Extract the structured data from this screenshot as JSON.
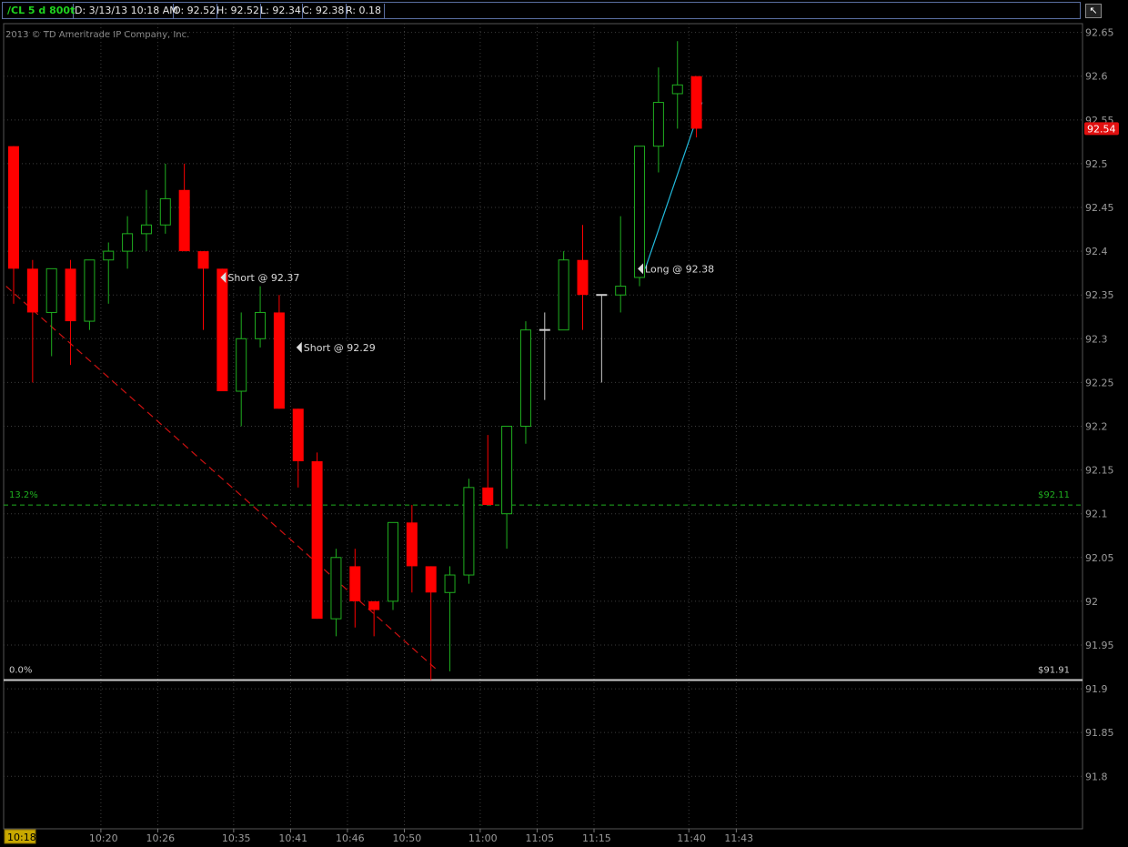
{
  "header": {
    "symbol": "/CL 5 d 800t",
    "date": "D: 3/13/13 10:18 AM",
    "open": "O: 92.52",
    "high": "H: 92.52",
    "low": "L: 92.34",
    "close": "C: 92.38",
    "range": "R: 0.18"
  },
  "copyright": "2013 © TD Ameritrade IP Company, Inc.",
  "colors": {
    "up": "#1fae1f",
    "down": "#ff0000",
    "neutral": "#cccccc",
    "fib": "#1fae1f",
    "trend_down": "#cc1111",
    "trend_up": "#22bbdd",
    "grid": "#3c3c3c",
    "price_tag": "#e01010"
  },
  "chart_data": {
    "type": "candlestick",
    "ylim": [
      91.74,
      92.66
    ],
    "y_ticks": [
      "92.65",
      "92.6",
      "92.55",
      "92.5",
      "92.45",
      "92.4",
      "92.35",
      "92.3",
      "92.25",
      "92.2",
      "92.15",
      "92.1",
      "92.05",
      "92",
      "91.95",
      "91.9",
      "91.85",
      "91.8"
    ],
    "x_labels": [
      {
        "bar": 0.3,
        "label": "10:18"
      },
      {
        "bar": 4.6,
        "label": "10:20"
      },
      {
        "bar": 7.6,
        "label": "10:26"
      },
      {
        "bar": 11.6,
        "label": "10:35"
      },
      {
        "bar": 14.6,
        "label": "10:41"
      },
      {
        "bar": 17.6,
        "label": "10:46"
      },
      {
        "bar": 20.6,
        "label": "10:50"
      },
      {
        "bar": 24.6,
        "label": "11:00"
      },
      {
        "bar": 27.6,
        "label": "11:05"
      },
      {
        "bar": 30.6,
        "label": "11:15"
      },
      {
        "bar": 35.6,
        "label": "11:40"
      },
      {
        "bar": 38.1,
        "label": "11:43"
      }
    ],
    "candles": [
      {
        "o": 92.52,
        "h": 92.52,
        "l": 92.34,
        "c": 92.38
      },
      {
        "o": 92.38,
        "h": 92.39,
        "l": 92.25,
        "c": 92.33
      },
      {
        "o": 92.33,
        "h": 92.38,
        "l": 92.28,
        "c": 92.38
      },
      {
        "o": 92.38,
        "h": 92.39,
        "l": 92.27,
        "c": 92.32
      },
      {
        "o": 92.32,
        "h": 92.39,
        "l": 92.31,
        "c": 92.39
      },
      {
        "o": 92.39,
        "h": 92.41,
        "l": 92.34,
        "c": 92.4
      },
      {
        "o": 92.4,
        "h": 92.44,
        "l": 92.38,
        "c": 92.42
      },
      {
        "o": 92.42,
        "h": 92.47,
        "l": 92.4,
        "c": 92.43
      },
      {
        "o": 92.43,
        "h": 92.5,
        "l": 92.42,
        "c": 92.46
      },
      {
        "o": 92.47,
        "h": 92.5,
        "l": 92.4,
        "c": 92.4
      },
      {
        "o": 92.4,
        "h": 92.4,
        "l": 92.31,
        "c": 92.38
      },
      {
        "o": 92.38,
        "h": 92.38,
        "l": 92.24,
        "c": 92.24
      },
      {
        "o": 92.24,
        "h": 92.33,
        "l": 92.2,
        "c": 92.3
      },
      {
        "o": 92.3,
        "h": 92.36,
        "l": 92.29,
        "c": 92.33
      },
      {
        "o": 92.33,
        "h": 92.35,
        "l": 92.22,
        "c": 92.22
      },
      {
        "o": 92.22,
        "h": 92.22,
        "l": 92.13,
        "c": 92.16
      },
      {
        "o": 92.16,
        "h": 92.17,
        "l": 91.98,
        "c": 91.98
      },
      {
        "o": 91.98,
        "h": 92.06,
        "l": 91.96,
        "c": 92.05
      },
      {
        "o": 92.04,
        "h": 92.06,
        "l": 91.97,
        "c": 92.0
      },
      {
        "o": 92.0,
        "h": 92.0,
        "l": 91.96,
        "c": 91.99
      },
      {
        "o": 92.0,
        "h": 92.09,
        "l": 91.99,
        "c": 92.09
      },
      {
        "o": 92.09,
        "h": 92.11,
        "l": 92.01,
        "c": 92.04
      },
      {
        "o": 92.04,
        "h": 92.04,
        "l": 91.91,
        "c": 92.01
      },
      {
        "o": 92.01,
        "h": 92.04,
        "l": 91.92,
        "c": 92.03
      },
      {
        "o": 92.03,
        "h": 92.14,
        "l": 92.02,
        "c": 92.13
      },
      {
        "o": 92.13,
        "h": 92.19,
        "l": 92.11,
        "c": 92.11
      },
      {
        "o": 92.1,
        "h": 92.2,
        "l": 92.06,
        "c": 92.2
      },
      {
        "o": 92.2,
        "h": 92.32,
        "l": 92.18,
        "c": 92.31
      },
      {
        "o": 92.31,
        "h": 92.33,
        "l": 92.23,
        "c": 92.31
      },
      {
        "o": 92.31,
        "h": 92.4,
        "l": 92.31,
        "c": 92.39
      },
      {
        "o": 92.39,
        "h": 92.43,
        "l": 92.31,
        "c": 92.35
      },
      {
        "o": 92.35,
        "h": 92.35,
        "l": 92.25,
        "c": 92.35
      },
      {
        "o": 92.35,
        "h": 92.44,
        "l": 92.33,
        "c": 92.36
      },
      {
        "o": 92.37,
        "h": 92.52,
        "l": 92.36,
        "c": 92.52
      },
      {
        "o": 92.52,
        "h": 92.61,
        "l": 92.49,
        "c": 92.57
      },
      {
        "o": 92.58,
        "h": 92.64,
        "l": 92.54,
        "c": 92.59
      },
      {
        "o": 92.6,
        "h": 92.6,
        "l": 92.53,
        "c": 92.54
      }
    ],
    "annotations": [
      {
        "bar": 11,
        "price": 92.37,
        "text": "Short @ 92.37"
      },
      {
        "bar": 15,
        "price": 92.29,
        "text": "Short @ 92.29"
      },
      {
        "bar": 33,
        "price": 92.38,
        "text": "Long @ 92.38"
      }
    ],
    "trendlines": [
      {
        "role": "trend_down",
        "from": [
          -0.4,
          92.36
        ],
        "to": [
          22.4,
          91.92
        ],
        "style": "dashed"
      },
      {
        "role": "trend_up",
        "from": [
          33.3,
          92.38
        ],
        "to": [
          36.3,
          92.57
        ],
        "style": "solid"
      }
    ],
    "fib_levels": [
      {
        "pct": "13.2%",
        "value": 92.11,
        "value_label": "$92.11",
        "role": "fib",
        "style": "dashed"
      },
      {
        "pct": "0.0%",
        "value": 91.91,
        "value_label": "$91.91",
        "role": "neutral",
        "style": "solid"
      }
    ],
    "last_price": "92.54",
    "last_value": 92.54
  }
}
